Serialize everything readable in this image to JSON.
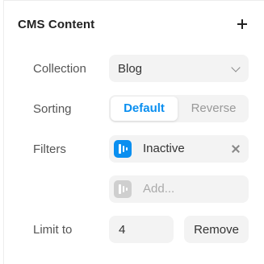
{
  "section": {
    "title": "CMS Content",
    "add_icon": "plus-icon"
  },
  "collection": {
    "label": "Collection",
    "value": "Blog",
    "icon": "chevron-down-icon"
  },
  "sorting": {
    "label": "Sorting",
    "options": [
      "Default",
      "Reverse"
    ],
    "selected": "Default",
    "accent_color": "#0a8ff0"
  },
  "filters": {
    "label": "Filters",
    "items": [
      {
        "text": "Inactive",
        "icon": "toggle-filter-icon",
        "active": true,
        "remove_icon": "close-icon"
      }
    ],
    "add_placeholder": "Add..."
  },
  "limit": {
    "label": "Limit to",
    "value": "4",
    "remove_label": "Remove"
  }
}
